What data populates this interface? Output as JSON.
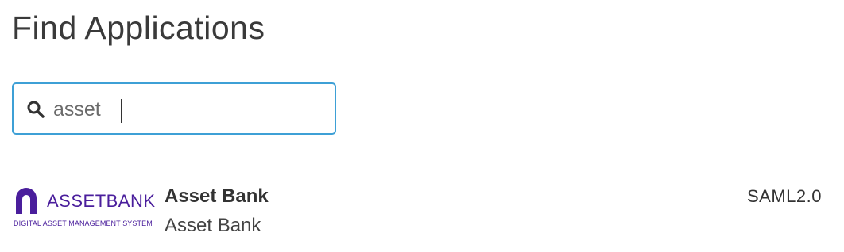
{
  "page": {
    "title": "Find Applications"
  },
  "search": {
    "value": "asset",
    "icon": "search-icon",
    "accent_color": "#3ea0d6"
  },
  "results": [
    {
      "logo": {
        "wordmark": "ASSETBANK",
        "tagline": "DIGITAL ASSET MANAGEMENT SYSTEM",
        "brand_color": "#4a1e9c"
      },
      "name": "Asset Bank",
      "subname": "Asset Bank",
      "protocol": "SAML2.0"
    }
  ]
}
